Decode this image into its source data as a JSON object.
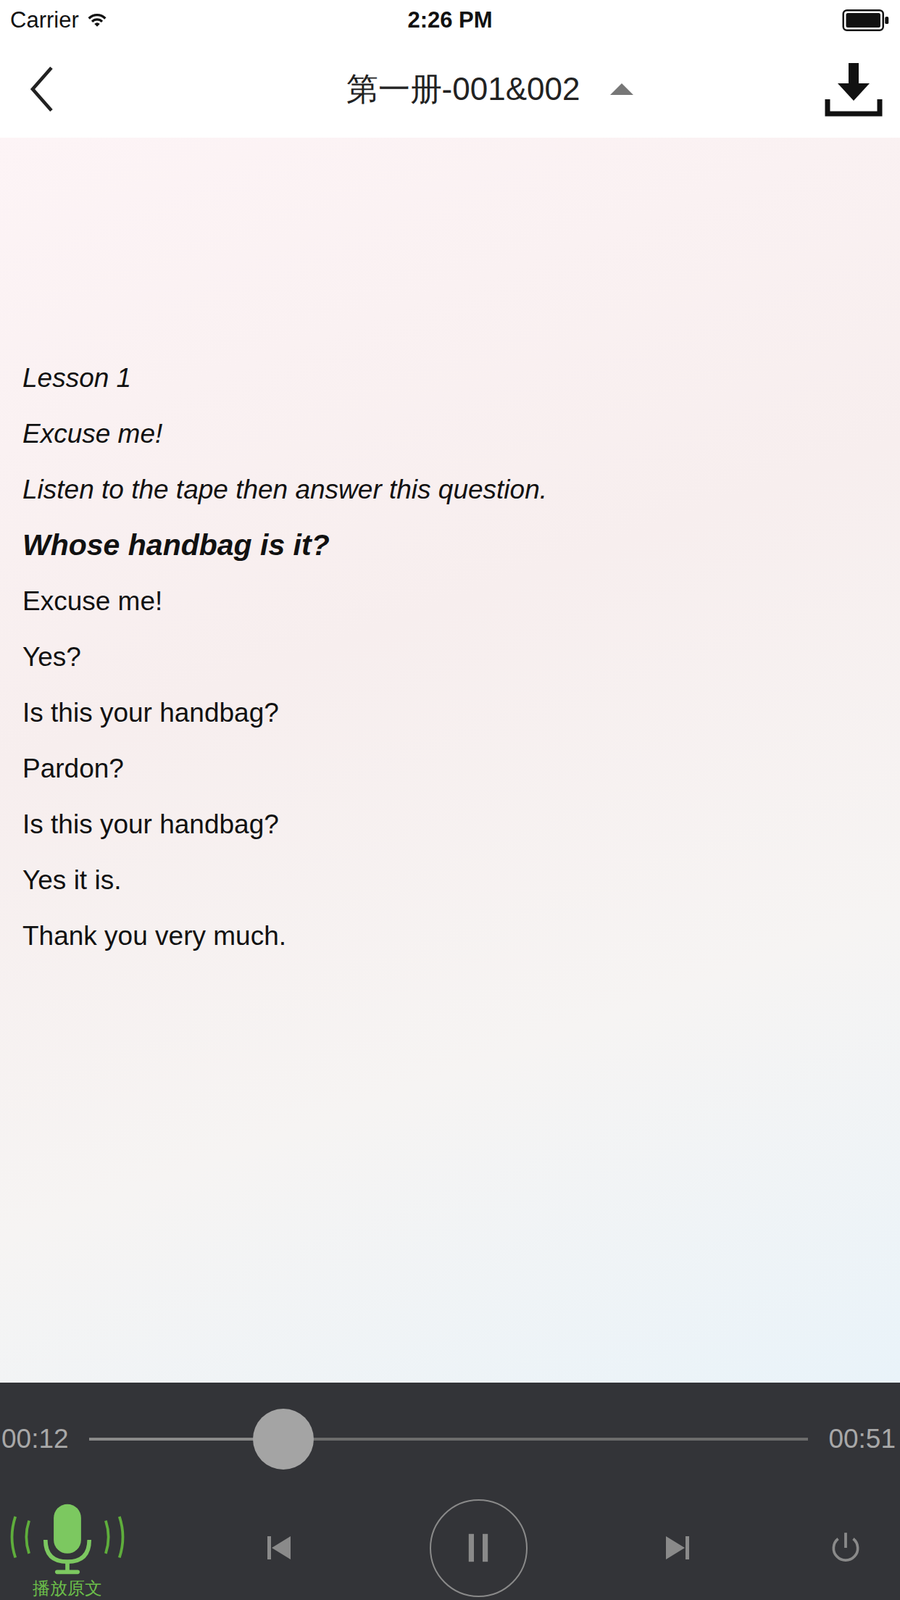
{
  "status_bar": {
    "carrier": "Carrier",
    "time": "2:26 PM"
  },
  "nav": {
    "title": "第一册-001&002"
  },
  "lines": [
    {
      "text": "Lesson 1",
      "kind": "italic"
    },
    {
      "text": "Excuse me!",
      "kind": "italic"
    },
    {
      "text": "Listen to the tape then answer this question.",
      "kind": "italic"
    },
    {
      "text": "Whose handbag is it?",
      "kind": "bold"
    },
    {
      "text": "Excuse me!",
      "kind": "normal"
    },
    {
      "text": "Yes?",
      "kind": "normal"
    },
    {
      "text": "Is this your handbag?",
      "kind": "normal"
    },
    {
      "text": "Pardon?",
      "kind": "normal"
    },
    {
      "text": "Is this your handbag?",
      "kind": "normal"
    },
    {
      "text": "Yes it is.",
      "kind": "normal"
    },
    {
      "text": "Thank you very much.",
      "kind": "normal"
    }
  ],
  "player": {
    "current": "00:12",
    "total": "00:51",
    "level": 0.27,
    "playing": true,
    "mic_label": "播放原文"
  }
}
